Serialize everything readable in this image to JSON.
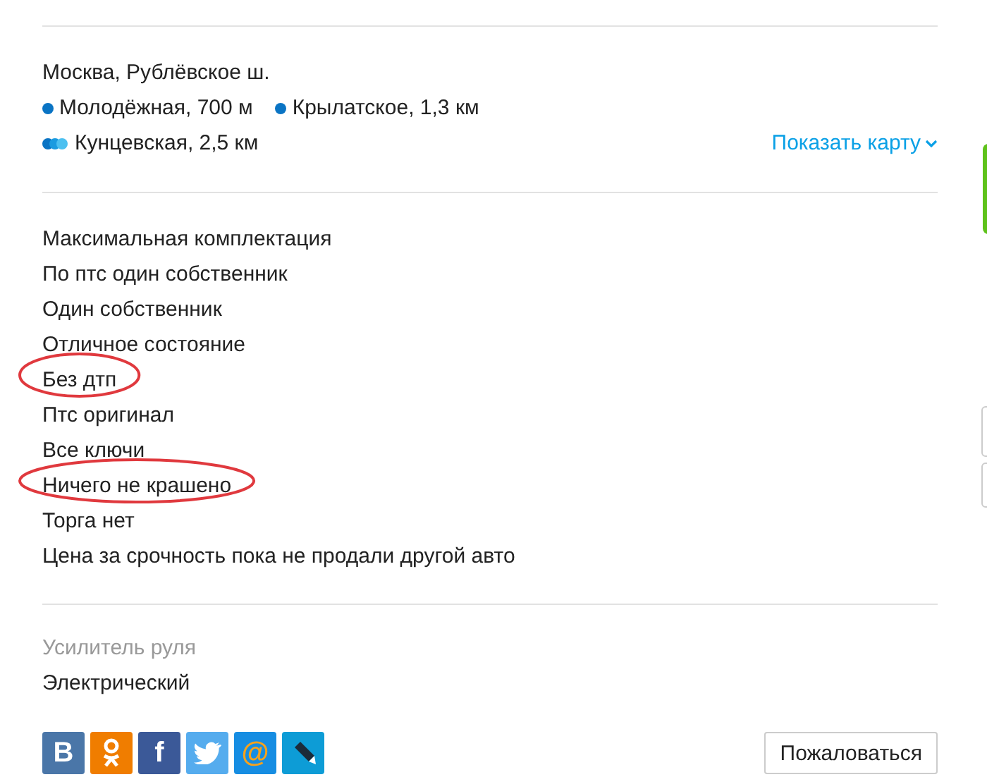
{
  "address": "Москва, Рублёвское ш.",
  "metro": [
    {
      "name": "Молодёжная, 700 м",
      "kind": "single"
    },
    {
      "name": "Крылатское, 1,3 км",
      "kind": "single"
    },
    {
      "name": "Кунцевская, 2,5 км",
      "kind": "triple"
    }
  ],
  "show_map": "Показать карту",
  "description": [
    {
      "text": "Максимальная комплектация",
      "circled": false
    },
    {
      "text": "По птс один собственник",
      "circled": false
    },
    {
      "text": "Один собственник",
      "circled": false
    },
    {
      "text": "Отличное состояние",
      "circled": false
    },
    {
      "text": "Без дтп",
      "circled": true
    },
    {
      "text": "Птс оригинал",
      "circled": false
    },
    {
      "text": "Все ключи",
      "circled": false
    },
    {
      "text": "Ничего не крашено",
      "circled": true
    },
    {
      "text": "Торга нет",
      "circled": false
    },
    {
      "text": "Цена за срочность пока не продали другой авто",
      "circled": false
    }
  ],
  "params": [
    {
      "label": "Усилитель руля",
      "value": "Электрический"
    }
  ],
  "share": [
    {
      "kind": "vk",
      "label": "B"
    },
    {
      "kind": "ok"
    },
    {
      "kind": "fb",
      "label": "f"
    },
    {
      "kind": "tw"
    },
    {
      "kind": "mail",
      "label": "@"
    },
    {
      "kind": "lj"
    }
  ],
  "complain": "Пожаловаться"
}
